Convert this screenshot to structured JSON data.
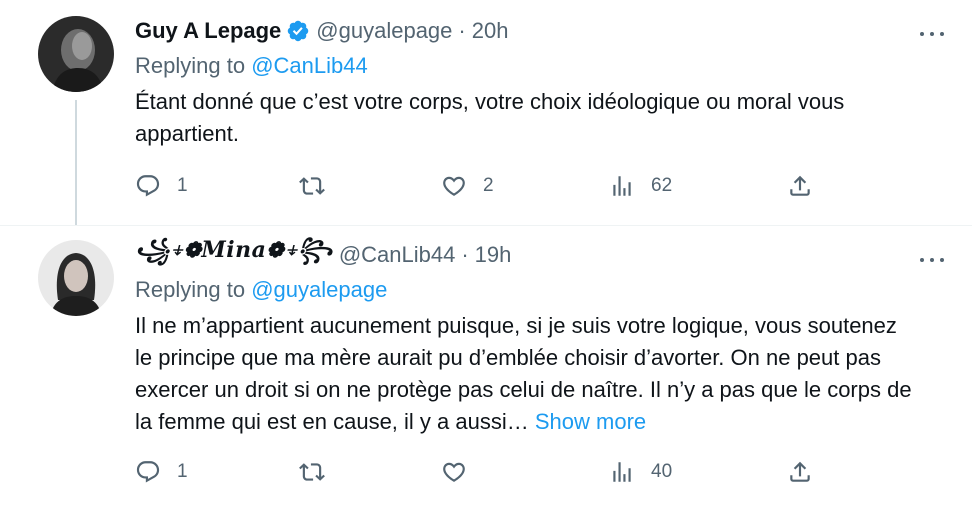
{
  "tweets": [
    {
      "author_name": "Guy A Lepage",
      "verified": true,
      "handle": "@guyalepage",
      "separator": "·",
      "time": "20h",
      "replying_prefix": "Replying to",
      "replying_to": "@CanLib44",
      "text": "Étant donné que c’est votre corps, votre choix idéologique ou moral vous appartient.",
      "show_more": "",
      "stats": {
        "replies": "1",
        "retweets": "",
        "likes": "2",
        "views": "62"
      }
    },
    {
      "author_name": "꧁⍖❁𝑴𝒊𝒏𝒂❁⍖꧂",
      "verified": false,
      "handle": "@CanLib44",
      "separator": "·",
      "time": "19h",
      "replying_prefix": "Replying to",
      "replying_to": "@guyalepage",
      "text": "Il ne m’appartient aucunement puisque, si je suis votre logique, vous soutenez le principe que ma mère aurait pu d’emblée choisir d’avorter. On ne peut pas exercer un droit si on ne protège pas celui de naître.  Il n’y a pas que le corps de la femme qui est en cause, il y a aussi…",
      "show_more": "Show more",
      "stats": {
        "replies": "1",
        "retweets": "",
        "likes": "",
        "views": "40"
      }
    }
  ],
  "icons": {
    "verified": "verified-badge-icon",
    "more": "more-dots-icon",
    "reply": "reply-icon",
    "retweet": "retweet-icon",
    "like": "heart-icon",
    "views": "views-icon",
    "share": "share-icon"
  },
  "colors": {
    "accent": "#1d9bf0",
    "secondary_text": "#536471",
    "primary_text": "#0f1419",
    "thread_line": "#cfd9de"
  }
}
